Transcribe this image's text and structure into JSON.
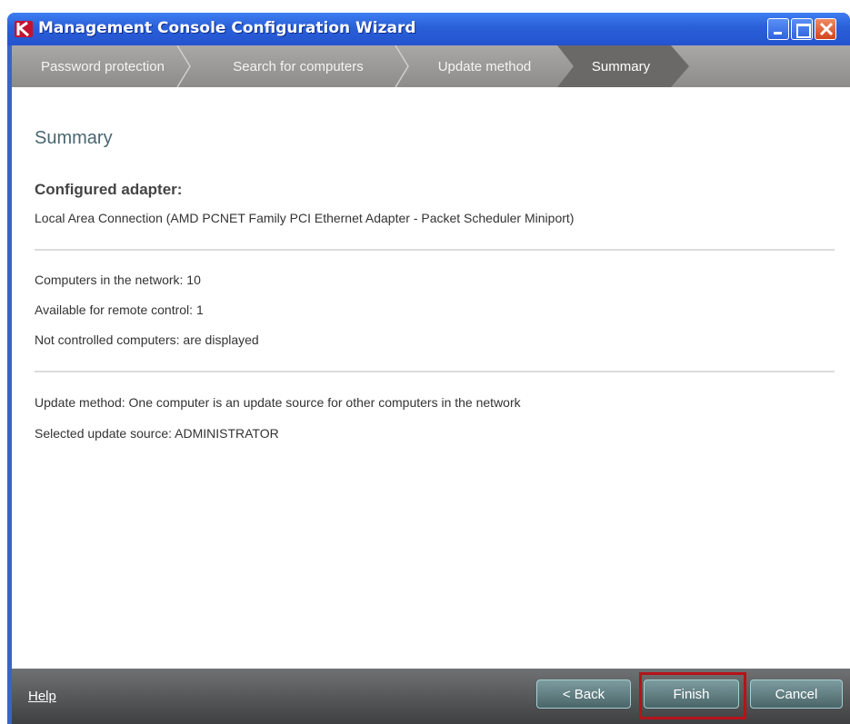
{
  "window": {
    "title": "Management Console Configuration Wizard"
  },
  "steps": [
    {
      "label": "Password protection",
      "active": false
    },
    {
      "label": "Search for computers",
      "active": false
    },
    {
      "label": "Update method",
      "active": false
    },
    {
      "label": "Summary",
      "active": true
    }
  ],
  "content": {
    "heading": "Summary",
    "adapter_label": "Configured adapter:",
    "adapter_value": "Local Area Connection (AMD PCNET Family PCI Ethernet Adapter - Packet Scheduler Miniport)",
    "network": {
      "computers_label": "Computers in the network:",
      "computers_value": "10",
      "remote_label": "Available for remote control:",
      "remote_value": "1",
      "not_controlled_label": "Not controlled computers:",
      "not_controlled_value": "are displayed"
    },
    "update": {
      "method_label": "Update method:",
      "method_value": "One computer is an update source for other computers in the network",
      "source_label": "Selected update source:",
      "source_value": "ADMINISTRATOR"
    }
  },
  "footer": {
    "help": "Help",
    "back": "< Back",
    "finish": "Finish",
    "cancel": "Cancel"
  },
  "colors": {
    "titlebar": "#2a5fd8",
    "heading": "#4a6670",
    "highlight": "#b8121a"
  },
  "icons": [
    "app-logo-icon",
    "minimize-icon",
    "maximize-icon",
    "close-icon"
  ]
}
